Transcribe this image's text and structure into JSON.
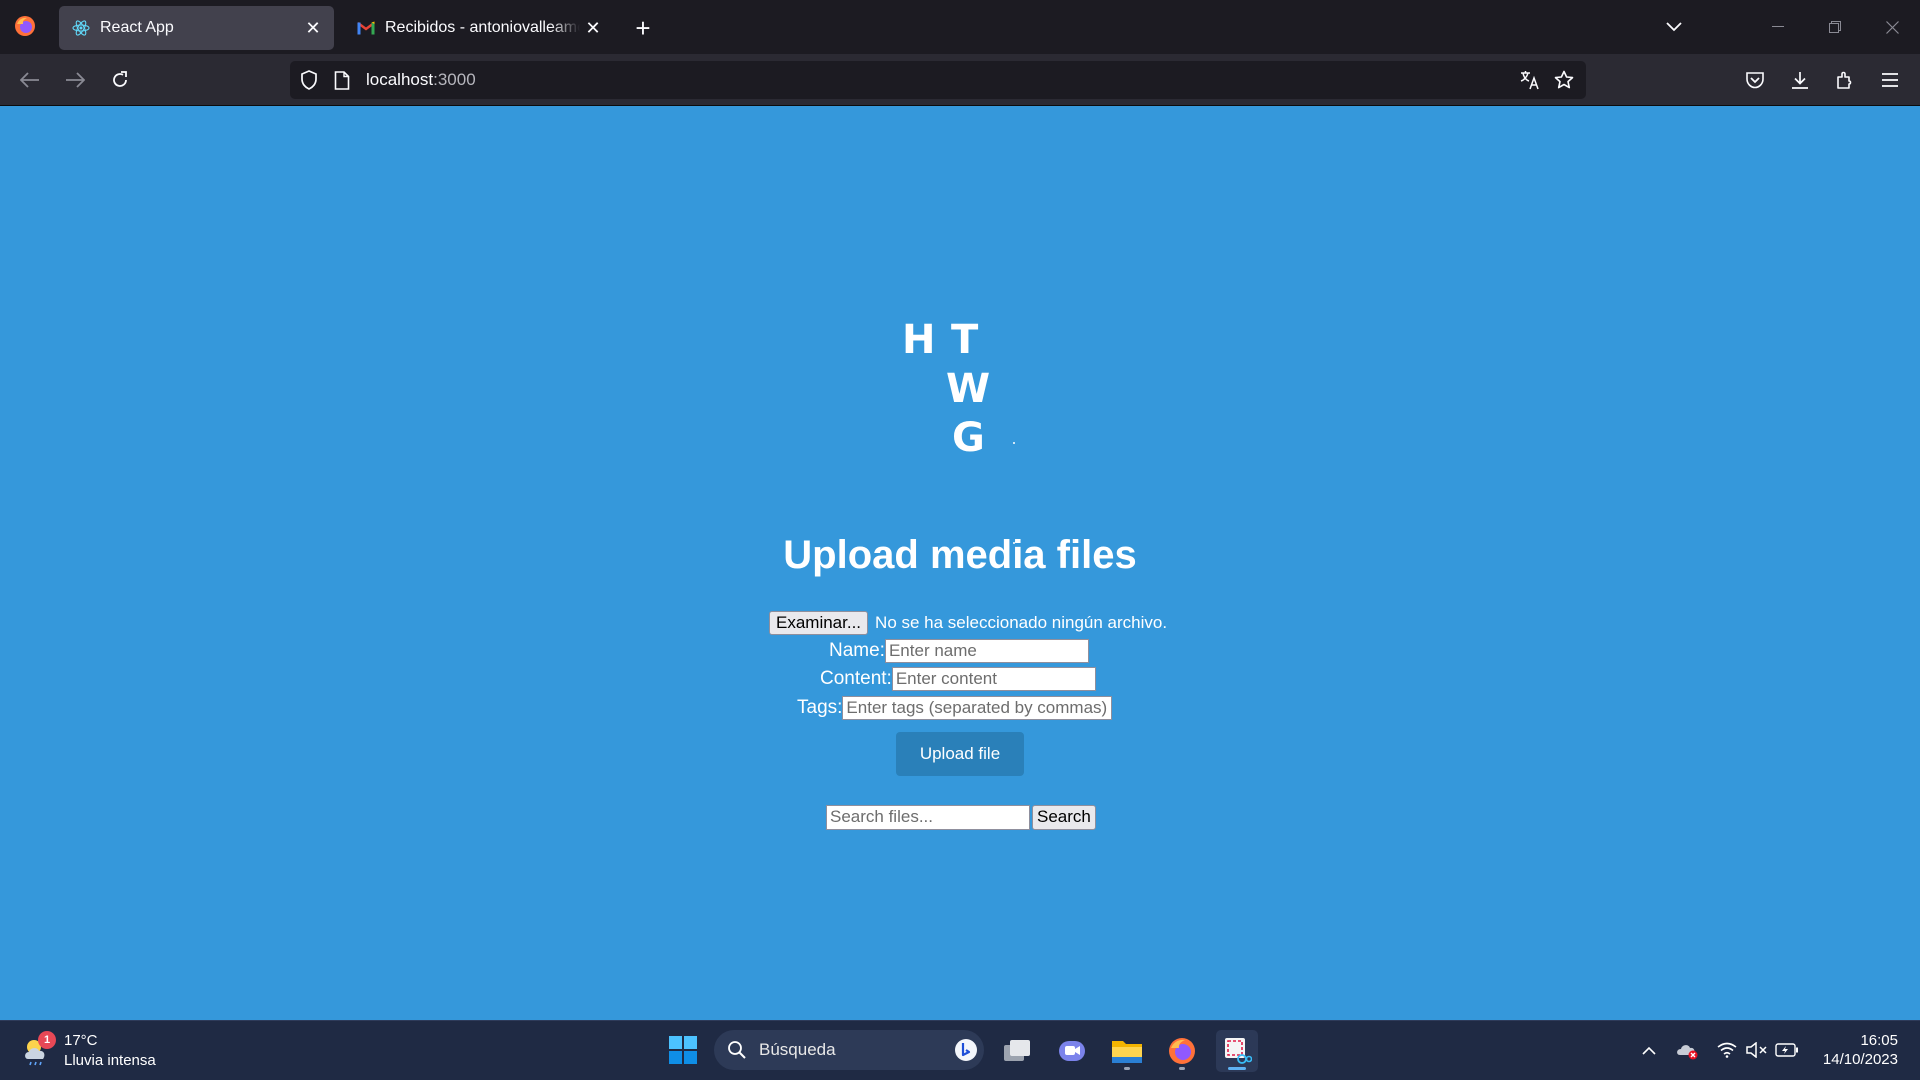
{
  "browser": {
    "tabs": [
      {
        "title": "React App",
        "icon": "react-icon",
        "active": true
      },
      {
        "title": "Recibidos - antoniovalleamodeo@gmail.com",
        "icon": "gmail-icon",
        "active": false
      }
    ],
    "address": {
      "host": "localhost",
      "port": ":3000"
    }
  },
  "page": {
    "logo_letters": {
      "l1": "H",
      "l2": "T",
      "l3": "W",
      "l4": "G"
    },
    "title": "Upload media files",
    "file_input": {
      "button_label": "Examinar...",
      "status": "No se ha seleccionado ningún archivo."
    },
    "fields": {
      "name": {
        "label": "Name:",
        "placeholder": "Enter name"
      },
      "content": {
        "label": "Content:",
        "placeholder": "Enter content"
      },
      "tags": {
        "label": "Tags:",
        "placeholder": "Enter tags (separated by commas)"
      }
    },
    "upload_button": "Upload file",
    "search": {
      "placeholder": "Search files...",
      "button": "Search"
    }
  },
  "taskbar": {
    "weather": {
      "badge": "1",
      "temp": "17°C",
      "desc": "Lluvia intensa"
    },
    "search_text": "Búsqueda",
    "clock": {
      "time": "16:05",
      "date": "14/10/2023"
    }
  },
  "colors": {
    "page_background": "#3598db",
    "upload_button": "#2a80b9",
    "tab_active": "#42414d",
    "chrome_dark": "#1c1b22"
  }
}
